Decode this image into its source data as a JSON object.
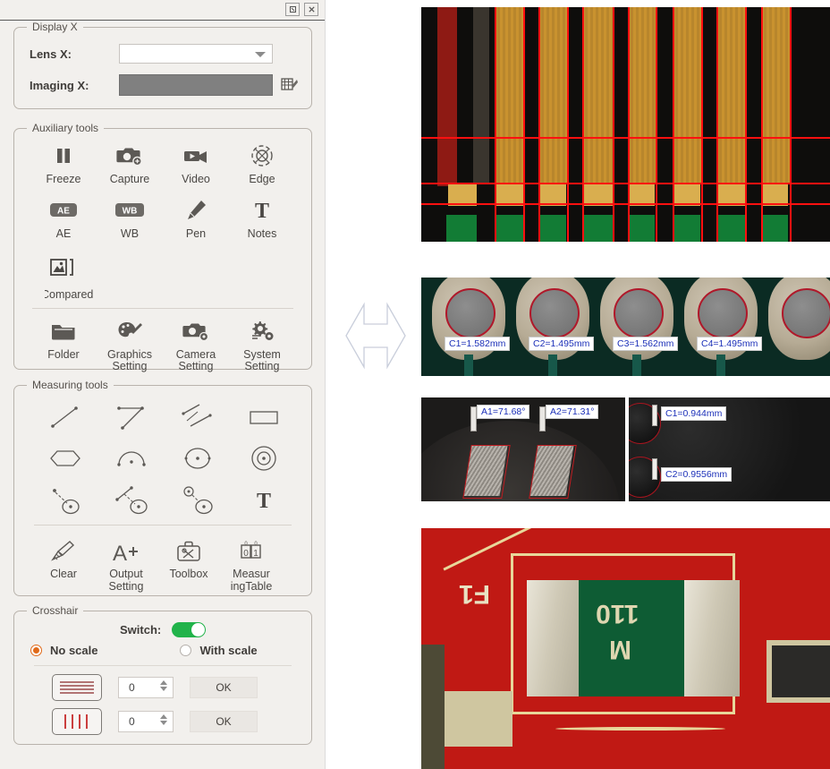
{
  "window": {
    "buttons": [
      {
        "name": "restore-window",
        "glyph": "❐"
      },
      {
        "name": "close-window",
        "glyph": "✕"
      }
    ]
  },
  "display_group": {
    "title": "Display X",
    "lens_label": "Lens X:",
    "lens_value": "",
    "lens_placeholder": "",
    "imaging_label": "Imaging X:",
    "imaging_value": "",
    "calibration_icon": "calibration-icon"
  },
  "auxiliary_group": {
    "title": "Auxiliary tools",
    "tools": [
      {
        "label": "Freeze",
        "icon": "pause-icon"
      },
      {
        "label": "Capture",
        "icon": "camera-add-icon"
      },
      {
        "label": "Video",
        "icon": "video-camera-icon"
      },
      {
        "label": "Edge",
        "icon": "edge-detect-icon"
      },
      {
        "label": "AE",
        "icon": "ae-badge-icon"
      },
      {
        "label": "WB",
        "icon": "wb-badge-icon"
      },
      {
        "label": "Pen",
        "icon": "pen-icon"
      },
      {
        "label": "Notes",
        "icon": "text-notes-icon"
      }
    ],
    "compared": {
      "label": "Compared",
      "icon": "compare-image-icon"
    },
    "settings": [
      {
        "label": "Folder",
        "icon": "folder-icon"
      },
      {
        "label": "Graphics Setting",
        "icon": "palette-icon"
      },
      {
        "label": "Camera Setting",
        "icon": "camera-gear-icon"
      },
      {
        "label": "System Setting",
        "icon": "gears-icon"
      }
    ]
  },
  "measuring_group": {
    "title": "Measuring tools",
    "tools": [
      {
        "icon": "line-measure-icon"
      },
      {
        "icon": "angle-measure-icon"
      },
      {
        "icon": "parallel-lines-measure-icon"
      },
      {
        "icon": "rectangle-measure-icon"
      },
      {
        "icon": "polygon-measure-icon"
      },
      {
        "icon": "arc-measure-icon"
      },
      {
        "icon": "circle-measure-icon"
      },
      {
        "icon": "concentric-circle-measure-icon"
      },
      {
        "icon": "point-to-circle-measure-icon"
      },
      {
        "icon": "line-to-circle-measure-icon"
      },
      {
        "icon": "circle-to-circle-measure-icon"
      },
      {
        "icon": "text-annotation-icon"
      }
    ],
    "actions": [
      {
        "label": "Clear",
        "icon": "broom-icon"
      },
      {
        "label": "Output Setting",
        "icon": "a-plus-icon"
      },
      {
        "label": "Toolbox",
        "icon": "toolbox-icon"
      },
      {
        "label": "MeasuringTable",
        "line1": "Measur",
        "line2": "ingTable",
        "icon": "measuring-table-icon"
      }
    ]
  },
  "crosshair_group": {
    "title": "Crosshair",
    "switch_label": "Switch:",
    "switch_on": true,
    "switch_color": "#21b34a",
    "radio_no_scale": "No scale",
    "radio_with_scale": "With scale",
    "selected_radio": "No scale",
    "radio_accent": "#e06a1a",
    "rows": [
      {
        "icon": "horizontal-lines-icon",
        "value": "0",
        "ok_label": "OK",
        "line_color": "#9b4a4a"
      },
      {
        "icon": "vertical-lines-icon",
        "value": "0",
        "ok_label": "OK",
        "line_color": "#c01111"
      }
    ]
  },
  "viewers": {
    "top": {
      "name": "cross-section-view",
      "crosshair_color": "#ff1010"
    },
    "middle_vias": {
      "name": "via-measurement-view",
      "labels": [
        "C1=1.582mm",
        "C2=1.495mm",
        "C3=1.562mm",
        "C4=1.495mm"
      ]
    },
    "angles": {
      "name": "angle-measurement-view",
      "labels": [
        "A1=71.68°",
        "A2=71.31°"
      ]
    },
    "holes": {
      "name": "hole-measurement-view",
      "labels": [
        "C1=0.944mm",
        "C2=0.9556mm"
      ]
    },
    "bottom": {
      "name": "pcb-fuse-view",
      "silkscreen": [
        "F1"
      ],
      "component_marking": [
        "110",
        "M"
      ],
      "pcb_color": "#c01914"
    }
  },
  "center_graphic": {
    "name": "double-arrow-icon"
  }
}
